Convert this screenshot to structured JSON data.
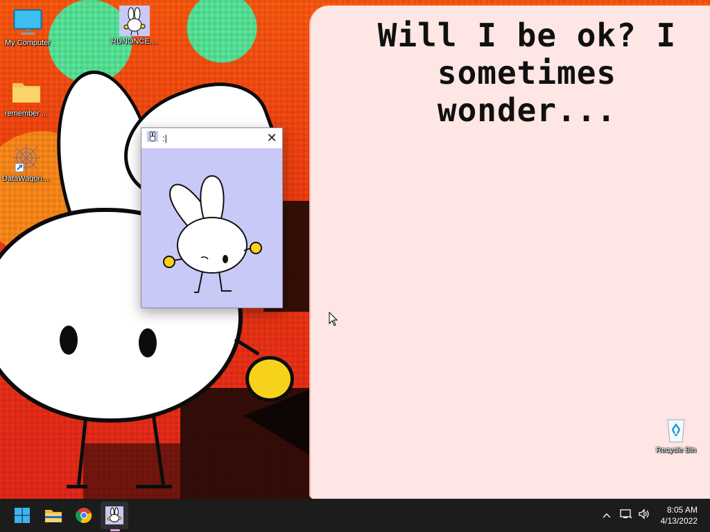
{
  "wallpaper": {
    "speech_line1": "Will I be ok? I",
    "speech_line2": "sometimes wonder..."
  },
  "desktop_icons": [
    {
      "label": "My Computer",
      "icon": "monitor-icon"
    },
    {
      "label": "RUNONCE....",
      "icon": "bunny-icon"
    },
    {
      "label": "remember ...",
      "icon": "folder-icon"
    },
    {
      "label": "DataWagon....",
      "icon": "datawagon-icon"
    },
    {
      "label": "Recycle Bin",
      "icon": "recycle-bin-icon"
    }
  ],
  "popup_window": {
    "title": ":|",
    "close_glyph": "✕"
  },
  "taskbar": {
    "apps": [
      "windows-start-icon",
      "file-explorer-icon",
      "chrome-icon",
      "bunny-app-icon"
    ],
    "tray": {
      "chevron": "^",
      "time": "8:05 AM",
      "date": "4/13/2022"
    }
  },
  "colors": {
    "accent_window_bg": "#c9c9f7",
    "speech_bg": "#fde6e4",
    "taskbar_bg": "#1c1c1c",
    "bunny_hand": "#f7d21a"
  }
}
